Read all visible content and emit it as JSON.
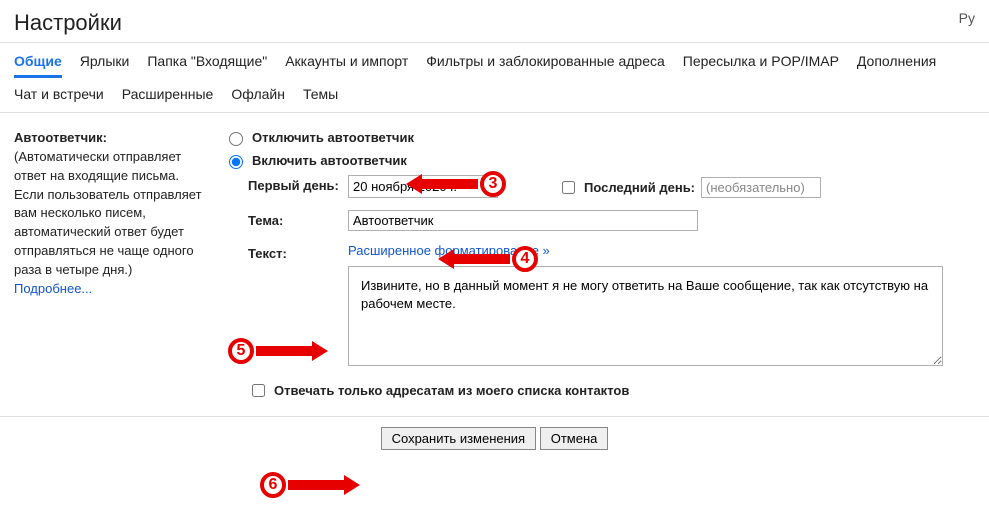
{
  "header": {
    "title": "Настройки",
    "lang": "Ру"
  },
  "tabs": {
    "primary": [
      "Общие",
      "Ярлыки",
      "Папка \"Входящие\"",
      "Аккаунты и импорт",
      "Фильтры и заблокированные адреса",
      "Пересылка и POP/IMAP",
      "Дополнения"
    ],
    "secondary": [
      "Чат и встречи",
      "Расширенные",
      "Офлайн",
      "Темы"
    ]
  },
  "sidebar": {
    "title": "Автоответчик:",
    "desc": "(Автоматически отправляет ответ на входящие письма. Если пользователь отправляет вам несколько писем, автоматический ответ будет отправляться не чаще одного раза в четыре дня.)",
    "more": "Подробнее..."
  },
  "form": {
    "radio_off": "Отключить автоответчик",
    "radio_on": "Включить автоответчик",
    "first_day_label": "Первый день:",
    "first_day_value": "20 ноября 2020 г.",
    "last_day_label": "Последний день:",
    "last_day_placeholder": "(необязательно)",
    "subject_label": "Тема:",
    "subject_value": "Автоответчик",
    "body_label": "Текст:",
    "rich_link": "Расширенное форматирование »",
    "body_value": "Извините, но в данный момент я не могу ответить на Ваше сообщение, так как отсутствую на рабочем месте.",
    "contacts_only": "Отвечать только адресатам из моего списка контактов",
    "save": "Сохранить изменения",
    "cancel": "Отмена"
  },
  "annotations": {
    "n3": "3",
    "n4": "4",
    "n5": "5",
    "n6": "6"
  }
}
